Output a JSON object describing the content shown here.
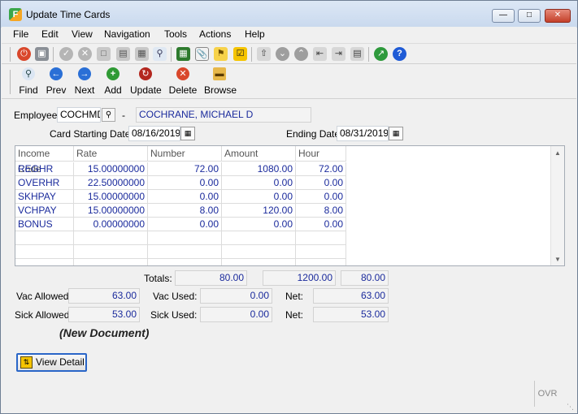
{
  "window": {
    "title": "Update Time Cards"
  },
  "menu": [
    "File",
    "Edit",
    "View",
    "Navigation",
    "Tools",
    "Actions",
    "Help"
  ],
  "toolbar_icons": [
    "power-icon",
    "copy-window-icon",
    "check-icon",
    "cancel-icon",
    "document-icon",
    "documents-icon",
    "table-icon",
    "zoom-icon",
    "calendar-icon",
    "attach-icon",
    "key-icon",
    "checklist-icon",
    "upload-icon",
    "down-circle-icon",
    "up-circle-icon",
    "export-icon",
    "import-icon",
    "archive-icon",
    "trend-icon",
    "help-icon"
  ],
  "nav": {
    "find": "Find",
    "prev": "Prev",
    "next": "Next",
    "add": "Add",
    "update": "Update",
    "delete": "Delete",
    "browse": "Browse"
  },
  "form": {
    "employee_label": "Employee",
    "employee_code": "COCHMD",
    "dash": "-",
    "employee_name": "COCHRANE, MICHAEL D",
    "card_start_label": "Card Starting Date",
    "card_start": "08/16/2019",
    "ending_label": "Ending Date",
    "ending": "08/31/2019"
  },
  "grid": {
    "headers": [
      "Income Code",
      "Rate",
      "Number",
      "Amount",
      "Hour"
    ],
    "rows": [
      [
        "REGHR",
        "15.00000000",
        "72.00",
        "1080.00",
        "72.00"
      ],
      [
        "OVERHR",
        "22.50000000",
        "0.00",
        "0.00",
        "0.00"
      ],
      [
        "SKHPAY",
        "15.00000000",
        "0.00",
        "0.00",
        "0.00"
      ],
      [
        "VCHPAY",
        "15.00000000",
        "8.00",
        "120.00",
        "8.00"
      ],
      [
        "BONUS",
        "0.00000000",
        "0.00",
        "0.00",
        "0.00"
      ]
    ]
  },
  "totals": {
    "label": "Totals:",
    "number": "80.00",
    "amount": "1200.00",
    "hour": "80.00"
  },
  "vac": {
    "allowed_label": "Vac Allowed:",
    "allowed": "63.00",
    "used_label": "Vac Used:",
    "used": "0.00",
    "net_label": "Net:",
    "net": "63.00"
  },
  "sick": {
    "allowed_label": "Sick Allowed:",
    "allowed": "53.00",
    "used_label": "Sick Used:",
    "used": "0.00",
    "net_label": "Net:",
    "net": "53.00"
  },
  "status": {
    "document": "(New Document)",
    "mode": "OVR"
  },
  "view_detail": "View Detail",
  "colors": {
    "value_text": "#1a2a9c",
    "title_bar": "#dce7f5"
  }
}
